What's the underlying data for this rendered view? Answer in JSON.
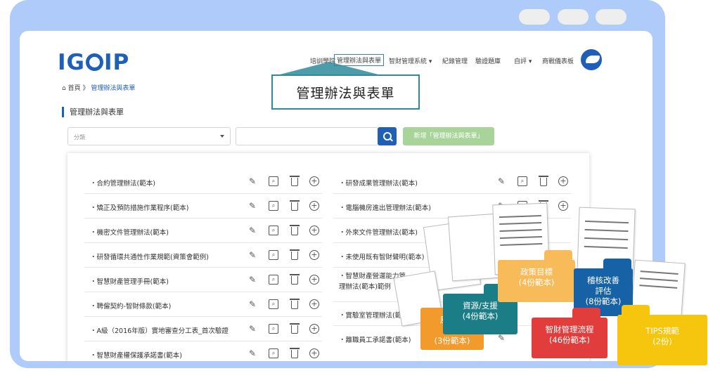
{
  "colors": {
    "brand": "#1f5fb8",
    "accent": "#2f8a9b",
    "frame": "#aecbf9",
    "add_button": "#a8d49a"
  },
  "logo": {
    "text_left": "IG",
    "text_right": "IP"
  },
  "nav": {
    "items": [
      "培訓學院",
      "管理辦法與表單",
      "智財管理系統",
      "紀錄管理",
      "驗證題庫",
      "自評",
      "商戰儀表板"
    ],
    "dropdown_mark": "▾"
  },
  "callout": {
    "text": "管理辦法與表單"
  },
  "breadcrumb": {
    "home": "首頁",
    "sep": "》",
    "current": "管理辦法與表單"
  },
  "section_title": "管理辦法與表單",
  "filter": {
    "category_placeholder": "分類",
    "add_button": "新增「管理辦法與表單」"
  },
  "left_items": [
    "・合約管理辦法(範本)",
    "・矯正及預防措施作業程序(範本)",
    "・機密文件管理辦法(範本)",
    "・研發循環共通性作業規範(資策會範例)",
    "・智慧財產管理手冊(範本)",
    "・聘僱契約-智財條款(範本)",
    "・A級（2016年版）實地審查分工表_首次驗證",
    "・智慧財產權保護承諾書(範本)"
  ],
  "right_items": [
    "・研發成果管理辦法(範本)",
    "・電腦機房進出管理辦法(範本)",
    "・外來文件管理辦法(範本)",
    "・未使用既有智財聲明(範本)",
    "・智慧財產營運能力管理辦法(範本)範例",
    "・實驗室管理辦法(範本)",
    "・離職員工承諾書(範本)"
  ],
  "icons": [
    "pencil-icon",
    "preview-icon",
    "trash-icon",
    "add-circle-icon"
  ],
  "folders": {
    "f1": "風險評\n評\n(3份範本)",
    "f2": "資源/支援\n(4份範本)",
    "f3": "政策目標\n(4份範本)",
    "f4": "稽核改善\n評估\n(8份範本)",
    "f5": "智財管理流程\n(46份範本)",
    "f6": "TIPS規範\n(2份)"
  }
}
